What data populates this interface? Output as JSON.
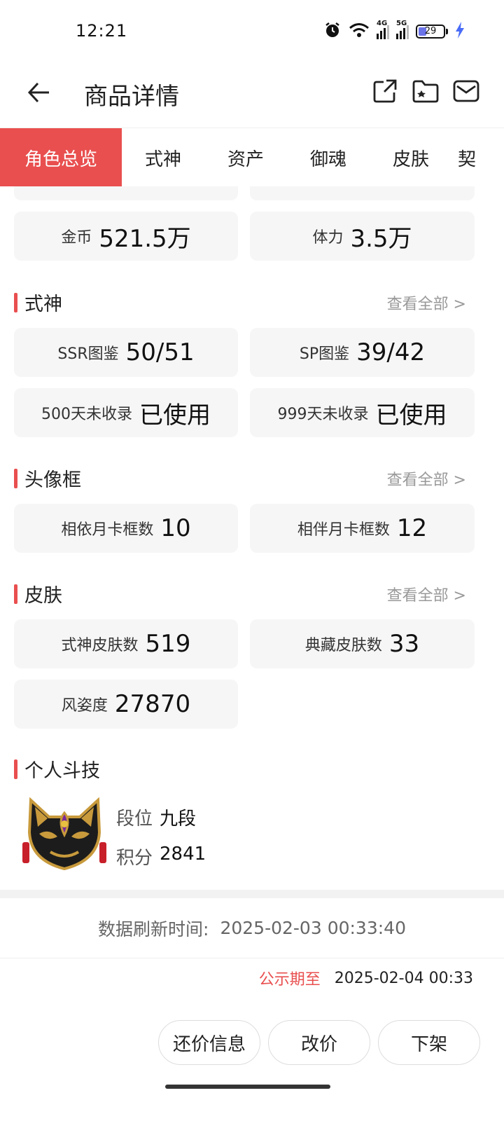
{
  "status_bar": {
    "time": "12:21",
    "signal_4g": "4G",
    "signal_5g": "5G",
    "battery": "29"
  },
  "header": {
    "title": "商品详情"
  },
  "tabs": [
    "角色总览",
    "式神",
    "资产",
    "御魂",
    "皮肤",
    "契"
  ],
  "assets": {
    "gold_label": "金币",
    "gold_value": "521.5万",
    "stamina_label": "体力",
    "stamina_value": "3.5万"
  },
  "shikigami": {
    "title": "式神",
    "view_all": "查看全部 >",
    "ssr_label": "SSR图鉴",
    "ssr_value": "50/51",
    "sp_label": "SP图鉴",
    "sp_value": "39/42",
    "d500_label": "500天未收录",
    "d500_value": "已使用",
    "d999_label": "999天未收录",
    "d999_value": "已使用"
  },
  "avatar_frame": {
    "title": "头像框",
    "view_all": "查看全部 >",
    "yi_label": "相依月卡框数",
    "yi_value": "10",
    "ban_label": "相伴月卡框数",
    "ban_value": "12"
  },
  "skins": {
    "title": "皮肤",
    "view_all": "查看全部 >",
    "shiki_label": "式神皮肤数",
    "shiki_value": "519",
    "dian_label": "典藏皮肤数",
    "dian_value": "33",
    "fz_label": "风姿度",
    "fz_value": "27870"
  },
  "arena": {
    "title": "个人斗技",
    "rank_label": "段位",
    "rank_value": "九段",
    "score_label": "积分",
    "score_value": "2841"
  },
  "refresh": {
    "label": "数据刷新时间:",
    "value": "2025-02-03 00:33:40"
  },
  "public": {
    "label": "公示期至",
    "value": "2025-02-04 00:33"
  },
  "actions": {
    "counter_offer": "还价信息",
    "change_price": "改价",
    "delist": "下架"
  },
  "colors": {
    "accent": "#e94f4f",
    "card_bg": "#f6f6f6"
  }
}
